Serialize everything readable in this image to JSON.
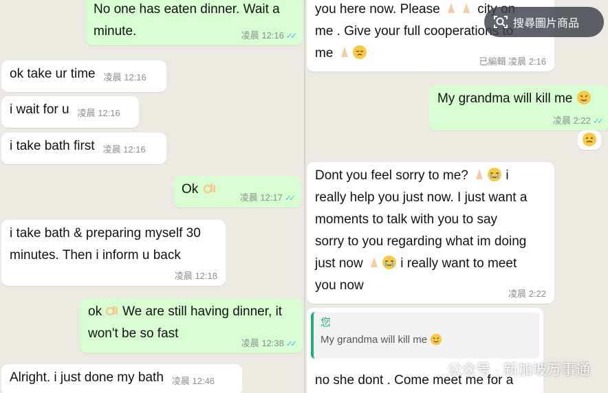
{
  "left_messages": [
    {
      "text": "No one has eaten dinner. Wait a\nminute.",
      "time": "凌晨 12:16"
    },
    {
      "text": "ok take ur time",
      "time": "凌晨 12:16"
    },
    {
      "text": "i wait for u",
      "time": "凌晨 12:16"
    },
    {
      "text": "i take bath first",
      "time": "凌晨 12:16"
    },
    {
      "text": "Ok",
      "time": "凌晨 12:17"
    },
    {
      "text": "i take bath & preparing myself 30\nminutes. Then i inform u back",
      "time": "凌晨 12:18"
    },
    {
      "text": "ok",
      "text2": "We are still having dinner, it\nwon't be so fast",
      "time": "凌晨 12:38"
    },
    {
      "text": "Alright. i just done my bath",
      "time": "凌晨 12:46"
    }
  ],
  "right_messages": [
    {
      "line1": "you here now. Please",
      "line1_tail": "city on",
      "line2": "me . Give your full cooperations to",
      "line3": "me",
      "edited": "已編輯",
      "time": "凌晨 2:16"
    },
    {
      "text": "My grandma will kill me",
      "time": "凌晨 2:22"
    },
    {
      "text": "Dont you feel sorry to me?",
      "text_tail": "i\nreally help you just now. I just want a\nmoments to talk with you to say\nsorry to you regarding what im doing\njust now",
      "text_tail2": "i really want to meet\nyou now",
      "time": "凌晨 2:22"
    },
    {
      "quote_author": "您",
      "quote_text": "My grandma will kill me",
      "text": "no she dont . Come meet me for a"
    }
  ],
  "overlay": {
    "search_label": "搜尋圖片商品",
    "watermark": "公众号 · 新加坡万事通"
  },
  "colors": {
    "incoming_bubble": "#ffffff",
    "outgoing_bubble": "#d9fdd3",
    "read_ticks": "#53bdeb",
    "quote_accent": "#25a884"
  }
}
